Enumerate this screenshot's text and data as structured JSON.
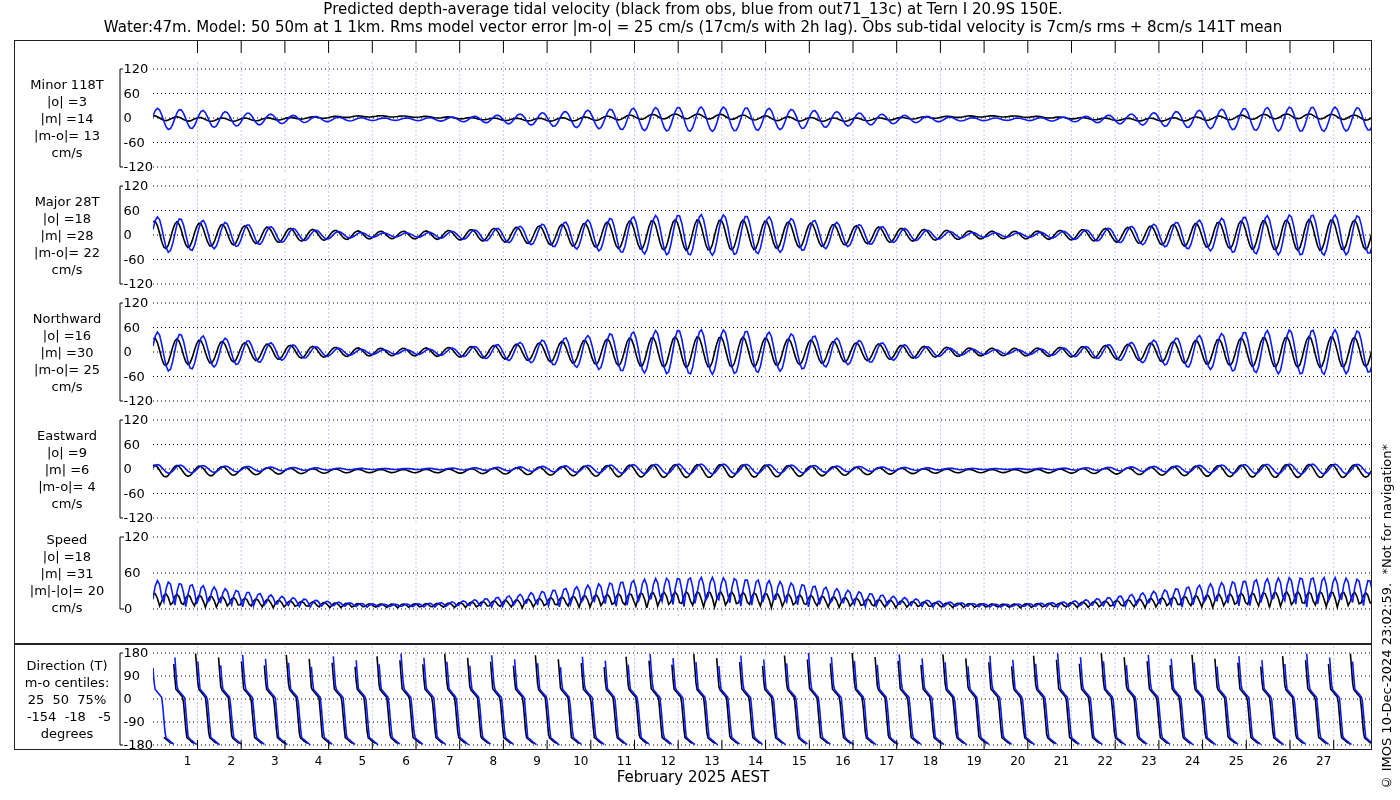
{
  "title": {
    "line_1": "Predicted depth-average tidal velocity (black from obs, blue from out71_13c) at Tern I 20.9S 150E.",
    "line_2": "Water:47m. Model: 50 50m at 1 1km. Rms model vector error |m-o| = 25 cm/s (17cm/s with 2h lag). Obs sub-tidal velocity is 7cm/s rms + 8cm/s 141T mean"
  },
  "panels": [
    {
      "kind": "signed",
      "label_lines": [
        "Minor 118T",
        "|o| =3",
        "|m| =14",
        "|m-o|= 13",
        "cm/s"
      ],
      "yticks": [
        "120",
        "60",
        "0",
        "-60",
        "-120"
      ]
    },
    {
      "kind": "signed",
      "label_lines": [
        "Major 28T",
        "|o| =18",
        "|m| =28",
        "|m-o|= 22",
        "cm/s"
      ],
      "yticks": [
        "120",
        "60",
        "0",
        "-60",
        "-120"
      ]
    },
    {
      "kind": "signed",
      "label_lines": [
        "Northward",
        "|o| =16",
        "|m| =30",
        "|m-o|= 25",
        "cm/s"
      ],
      "yticks": [
        "120",
        "60",
        "0",
        "-60",
        "-120"
      ]
    },
    {
      "kind": "signed",
      "label_lines": [
        "Eastward",
        "|o| =9",
        "|m| =6",
        "|m-o|= 4",
        "cm/s"
      ],
      "yticks": [
        "120",
        "60",
        "0",
        "-60",
        "-120"
      ]
    },
    {
      "kind": "speed",
      "label_lines": [
        "Speed",
        "|o| =18",
        "|m| =31",
        "|m|-|o|= 20",
        "cm/s"
      ],
      "yticks": [
        "120",
        "60",
        "0"
      ]
    },
    {
      "kind": "direction",
      "label_lines": [
        "Direction (T)",
        "m-o centiles:",
        "25  50  75%",
        " -154  -18   -5",
        "degrees"
      ],
      "yticks": [
        "180",
        "90",
        "0",
        "-90",
        "-180"
      ]
    }
  ],
  "x_axis": {
    "day_labels": [
      "1",
      "2",
      "3",
      "4",
      "5",
      "6",
      "7",
      "8",
      "9",
      "10",
      "11",
      "12",
      "13",
      "14",
      "15",
      "16",
      "17",
      "18",
      "19",
      "20",
      "21",
      "22",
      "23",
      "24",
      "25",
      "26",
      "27"
    ],
    "label": "February 2025 AEST"
  },
  "side_note": "© IMOS 10-Dec-2024 23:02:59.  *Not for navigation*"
}
